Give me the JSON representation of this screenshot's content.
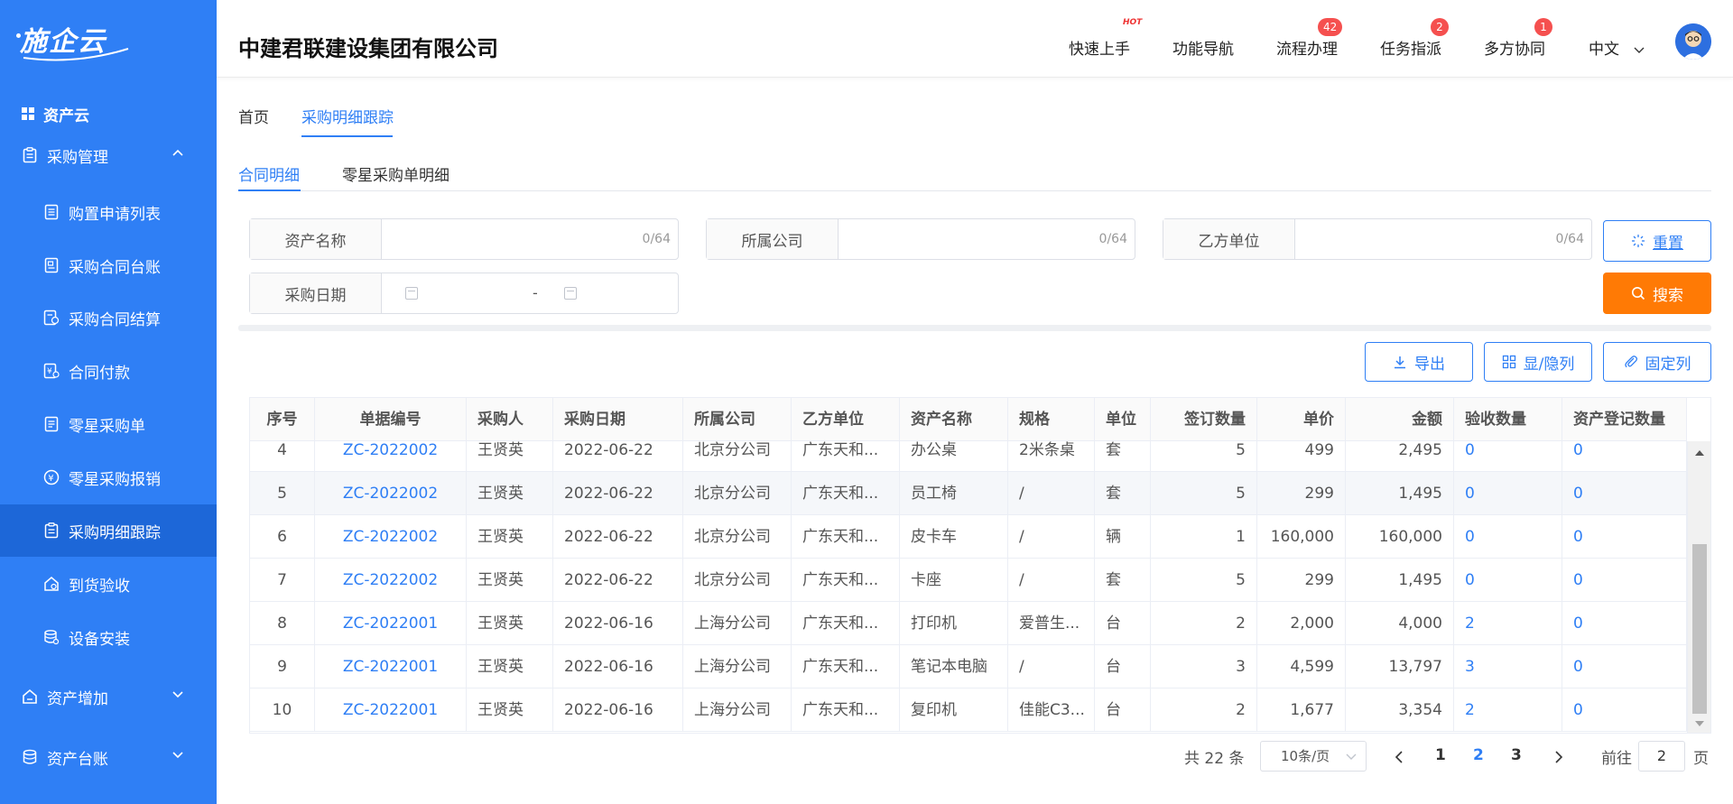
{
  "app": {
    "logo": "施企云",
    "company": "中建君联建设集团有限公司"
  },
  "header": {
    "nav": [
      {
        "label": "快速上手",
        "badge": "HOT"
      },
      {
        "label": "功能导航",
        "badge": ""
      },
      {
        "label": "流程办理",
        "badge": "42"
      },
      {
        "label": "任务指派",
        "badge": "2"
      },
      {
        "label": "多方协同",
        "badge": "1"
      }
    ],
    "language": "中文"
  },
  "sidebar": {
    "top": "资产云",
    "groups": [
      {
        "label": "采购管理",
        "expanded": true
      },
      {
        "label": "资产增加",
        "expanded": false
      },
      {
        "label": "资产台账",
        "expanded": false
      }
    ],
    "items": [
      {
        "label": "购置申请列表",
        "icon": "document-list-icon"
      },
      {
        "label": "采购合同台账",
        "icon": "contract-ledger-icon"
      },
      {
        "label": "采购合同结算",
        "icon": "contract-settle-icon"
      },
      {
        "label": "合同付款",
        "icon": "payment-icon"
      },
      {
        "label": "零星采购单",
        "icon": "order-icon"
      },
      {
        "label": "零星采购报销",
        "icon": "yen-icon"
      },
      {
        "label": "采购明细跟踪",
        "icon": "tracking-icon",
        "active": true
      },
      {
        "label": "到货验收",
        "icon": "warehouse-icon"
      },
      {
        "label": "设备安装",
        "icon": "install-icon"
      }
    ]
  },
  "page_tabs": [
    "首页",
    "采购明细跟踪"
  ],
  "sub_tabs": [
    "合同明细",
    "零星采购单明细"
  ],
  "filters": {
    "asset_name": {
      "label": "资产名称",
      "value": "",
      "count": "0/64"
    },
    "company": {
      "label": "所属公司",
      "value": "",
      "count": "0/64"
    },
    "party_b": {
      "label": "乙方单位",
      "value": "",
      "count": "0/64"
    },
    "date": {
      "label": "采购日期",
      "separator": "-"
    }
  },
  "buttons": {
    "reset": "重置",
    "search": "搜索",
    "export": "导出",
    "toggle_columns": "显/隐列",
    "pin_columns": "固定列"
  },
  "table": {
    "columns": [
      "序号",
      "单据编号",
      "采购人",
      "采购日期",
      "所属公司",
      "乙方单位",
      "资产名称",
      "规格",
      "单位",
      "签订数量",
      "单价",
      "金额",
      "验收数量",
      "资产登记数量"
    ],
    "rows": [
      {
        "no": "4",
        "code": "ZC-2022002",
        "buyer": "王贤英",
        "date": "2022-06-22",
        "company": "北京分公司",
        "partyb": "广东天和...",
        "asset": "办公桌",
        "spec": "2米条桌",
        "unit": "套",
        "qty": "5",
        "price": "499",
        "amount": "2,495",
        "accepted": "0",
        "registered": "0"
      },
      {
        "no": "5",
        "code": "ZC-2022002",
        "buyer": "王贤英",
        "date": "2022-06-22",
        "company": "北京分公司",
        "partyb": "广东天和...",
        "asset": "员工椅",
        "spec": "/",
        "unit": "套",
        "qty": "5",
        "price": "299",
        "amount": "1,495",
        "accepted": "0",
        "registered": "0"
      },
      {
        "no": "6",
        "code": "ZC-2022002",
        "buyer": "王贤英",
        "date": "2022-06-22",
        "company": "北京分公司",
        "partyb": "广东天和...",
        "asset": "皮卡车",
        "spec": "/",
        "unit": "辆",
        "qty": "1",
        "price": "160,000",
        "amount": "160,000",
        "accepted": "0",
        "registered": "0"
      },
      {
        "no": "7",
        "code": "ZC-2022002",
        "buyer": "王贤英",
        "date": "2022-06-22",
        "company": "北京分公司",
        "partyb": "广东天和...",
        "asset": "卡座",
        "spec": "/",
        "unit": "套",
        "qty": "5",
        "price": "299",
        "amount": "1,495",
        "accepted": "0",
        "registered": "0"
      },
      {
        "no": "8",
        "code": "ZC-2022001",
        "buyer": "王贤英",
        "date": "2022-06-16",
        "company": "上海分公司",
        "partyb": "广东天和...",
        "asset": "打印机",
        "spec": "爱普生...",
        "unit": "台",
        "qty": "2",
        "price": "2,000",
        "amount": "4,000",
        "accepted": "2",
        "registered": "0"
      },
      {
        "no": "9",
        "code": "ZC-2022001",
        "buyer": "王贤英",
        "date": "2022-06-16",
        "company": "上海分公司",
        "partyb": "广东天和...",
        "asset": "笔记本电脑",
        "spec": "/",
        "unit": "台",
        "qty": "3",
        "price": "4,599",
        "amount": "13,797",
        "accepted": "3",
        "registered": "0"
      },
      {
        "no": "10",
        "code": "ZC-2022001",
        "buyer": "王贤英",
        "date": "2022-06-16",
        "company": "上海分公司",
        "partyb": "广东天和...",
        "asset": "复印机",
        "spec": "佳能C3...",
        "unit": "台",
        "qty": "2",
        "price": "1,677",
        "amount": "3,354",
        "accepted": "2",
        "registered": "0"
      }
    ]
  },
  "pagination": {
    "total": "共 22 条",
    "page_size": "10条/页",
    "pages": [
      "1",
      "2",
      "3"
    ],
    "current": "2",
    "goto_label": "前往",
    "goto_value": "2",
    "page_suffix": "页"
  }
}
